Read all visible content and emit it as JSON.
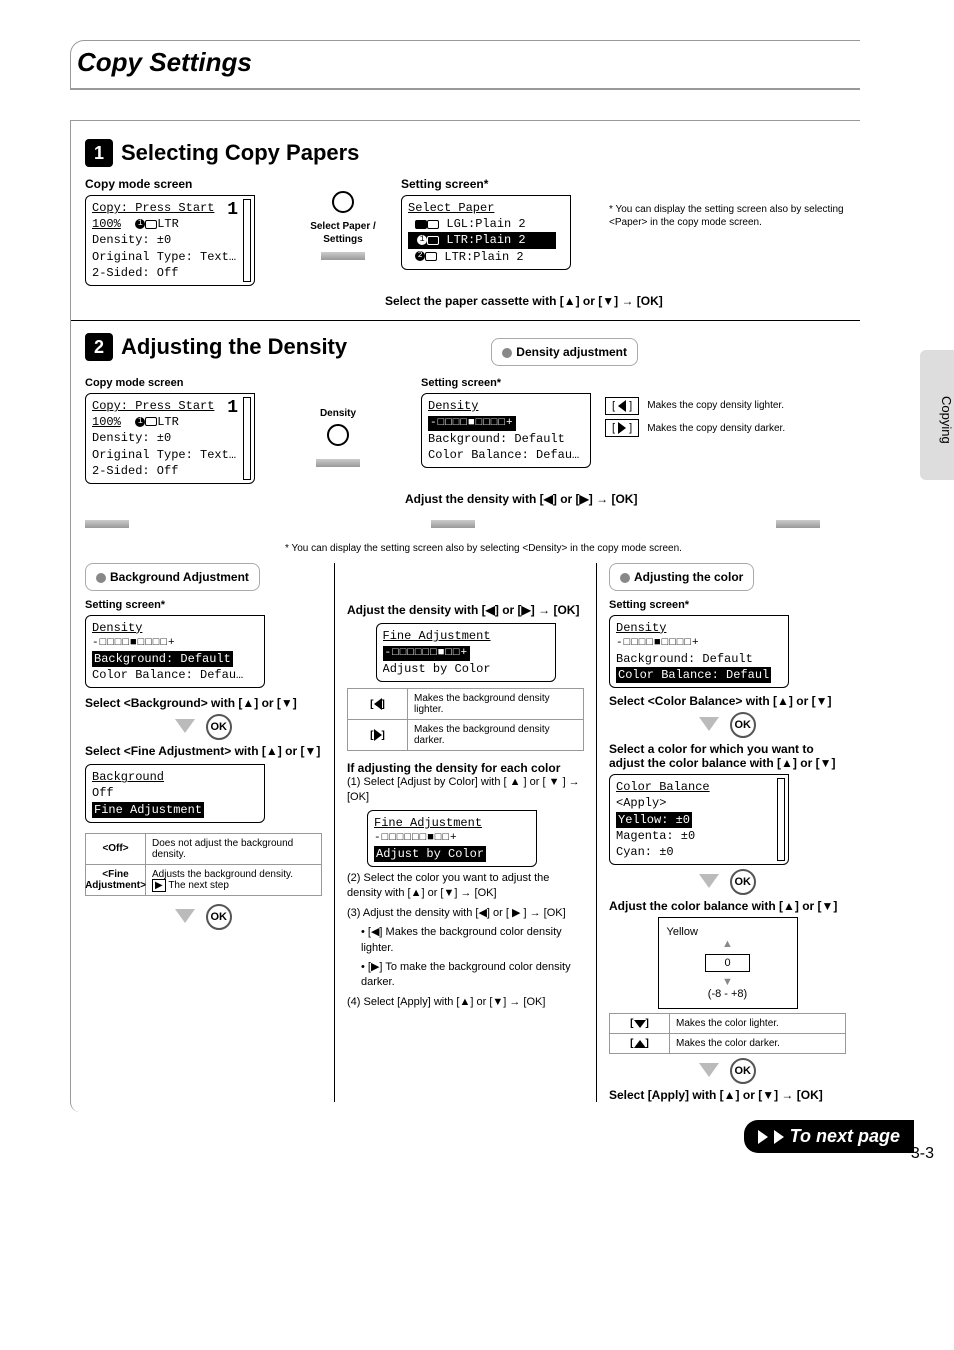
{
  "page_title": "Copy Settings",
  "side_tab": "Copying",
  "page_number": "3-3",
  "to_next": "To next page",
  "section1": {
    "num": "1",
    "title": "Selecting Copy Papers",
    "copy_mode_label": "Copy mode screen",
    "setting_label": "Setting screen*",
    "copy_lcd": {
      "l1a": "Copy: Press Start",
      "l2a": "100%",
      "l2b": "LTR",
      "counter": "1",
      "l3": "Density: ±0",
      "l4": "Original Type: Text…",
      "l5": "2-Sided: Off"
    },
    "mid_label": "Select Paper / Settings",
    "paper_lcd": {
      "title": "Select Paper",
      "r1": "LGL:Plain 2",
      "r2": "LTR:Plain 2",
      "r3": "LTR:Plain 2"
    },
    "footnote": "* You can display the setting screen also by selecting <Paper> in the copy mode screen.",
    "instruction": "Select the paper cassette with [▲] or [▼] → [OK]"
  },
  "section2": {
    "num": "2",
    "title": "Adjusting the Density",
    "panel_label": "Density adjustment",
    "copy_mode_label": "Copy mode screen",
    "setting_label": "Setting screen*",
    "mid_label": "Density",
    "density_lcd": {
      "title": "Density",
      "slider": "-□□□□■□□□□+",
      "l2": "Background: Default",
      "l3": "Color Balance: Defau…"
    },
    "key_left_desc": "Makes the copy density lighter.",
    "key_right_desc": "Makes the copy density darker.",
    "instruction": "Adjust the density with [◀] or [▶] → [OK]",
    "sub_note": "*  You can display the setting screen also by selecting <Density> in the copy mode screen.",
    "colA": {
      "heading": "Background Adjustment",
      "setting_label": "Setting screen*",
      "lcd": {
        "title": "Density",
        "slider": "-□□□□■□□□□+",
        "hl": "Background: Default",
        "l3": "Color Balance: Defau…"
      },
      "step1": "Select <Background> with [▲] or [▼]",
      "step2": "Select <Fine Adjustment> with [▲] or [▼]",
      "bg_lcd": {
        "title": "Background",
        "l1": "Off",
        "hl": "Fine Adjustment"
      },
      "tbl_off_l": "<Off>",
      "tbl_off_d": "Does not adjust the background density.",
      "tbl_fa_l": "<Fine Adjustment>",
      "tbl_fa_d1": "Adjusts the background density.",
      "tbl_fa_d2": "The next step"
    },
    "colB": {
      "step1": "Adjust the density with [◀] or [▶] → [OK]",
      "fa_lcd": {
        "title": "Fine Adjustment",
        "slider": "-□□□□□□■□□+",
        "l2": "Adjust by Color"
      },
      "k_left": "Makes the background density lighter.",
      "k_right": "Makes the background density darker.",
      "heading2": "If adjusting the density for each color",
      "s1": "(1) Select [Adjust by Color] with [ ▲ ] or [ ▼ ] → [OK]",
      "fa2_lcd": {
        "title": "Fine Adjustment",
        "slider": "-□□□□□□■□□+",
        "hl": "Adjust by Color"
      },
      "s2": "(2) Select the color you want to adjust the density with [▲] or [▼] → [OK]",
      "s3": "(3) Adjust the density with [◀] or [ ▶ ] → [OK]",
      "s3a": "• [◀] Makes the background color density lighter.",
      "s3b": "• [▶] To make the background color density darker.",
      "s4": "(4) Select [Apply] with [▲] or [▼] → [OK]"
    },
    "colC": {
      "heading": "Adjusting the color",
      "setting_label": "Setting screen*",
      "lcd": {
        "title": "Density",
        "slider": "-□□□□■□□□□+",
        "l2": "Background: Default",
        "hl": "Color Balance: Defaul"
      },
      "step1": "Select <Color Balance> with [▲] or [▼]",
      "step2": "Select a color for which you want to adjust the color balance with [▲] or [▼]",
      "cb_lcd": {
        "title": "Color Balance",
        "l0": "<Apply>",
        "hl": "Yellow:  ±0",
        "l2": "Magenta:  ±0",
        "l3": "Cyan:  ±0"
      },
      "step3": "Adjust the color balance with [▲] or [▼]",
      "yellow_label": "Yellow",
      "yellow_val": "0",
      "yellow_range": "(-8 - +8)",
      "k_down": "Makes the color lighter.",
      "k_up": "Makes the color darker.",
      "step4": "Select [Apply] with [▲] or [▼] → [OK]"
    }
  }
}
